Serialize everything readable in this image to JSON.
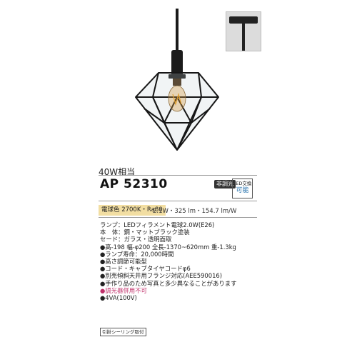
{
  "product": {
    "watt_equivalent": "40W相当",
    "model_number": "AP 52310",
    "dimmer_badge": "非調光",
    "led_swap_badge": {
      "top": "LED交換",
      "bottom": "可能"
    },
    "color_temp_badge": "電球色 2700K・Ra80",
    "efficiency": "2.1W・325 lm・154.7 lm/W",
    "specs": [
      "ランプ：LEDフィラメント電球2.0W(E26)",
      "本　体：鋼・マットブラック塗装",
      "セード：ガラス・透明面取",
      "●高-198 幅-φ200 全長-1370~620mm 重-1.3kg",
      "●ランプ寿命：20,000時間",
      "●高さ調節可能型",
      "●コード・キャブタイヤコードφ6",
      "●別売傾斜天井用フランジ対応(AEE590016)",
      "●手作り品のため写真と多少異なることがあります",
      "●調光器併用不可",
      "●4VA(100V)"
    ],
    "ceiling_badge": "引掛シーリング取付"
  },
  "colors": {
    "cream": "#f2dea2",
    "warning": "#c0306a",
    "accent_blue": "#1a6aa8"
  }
}
